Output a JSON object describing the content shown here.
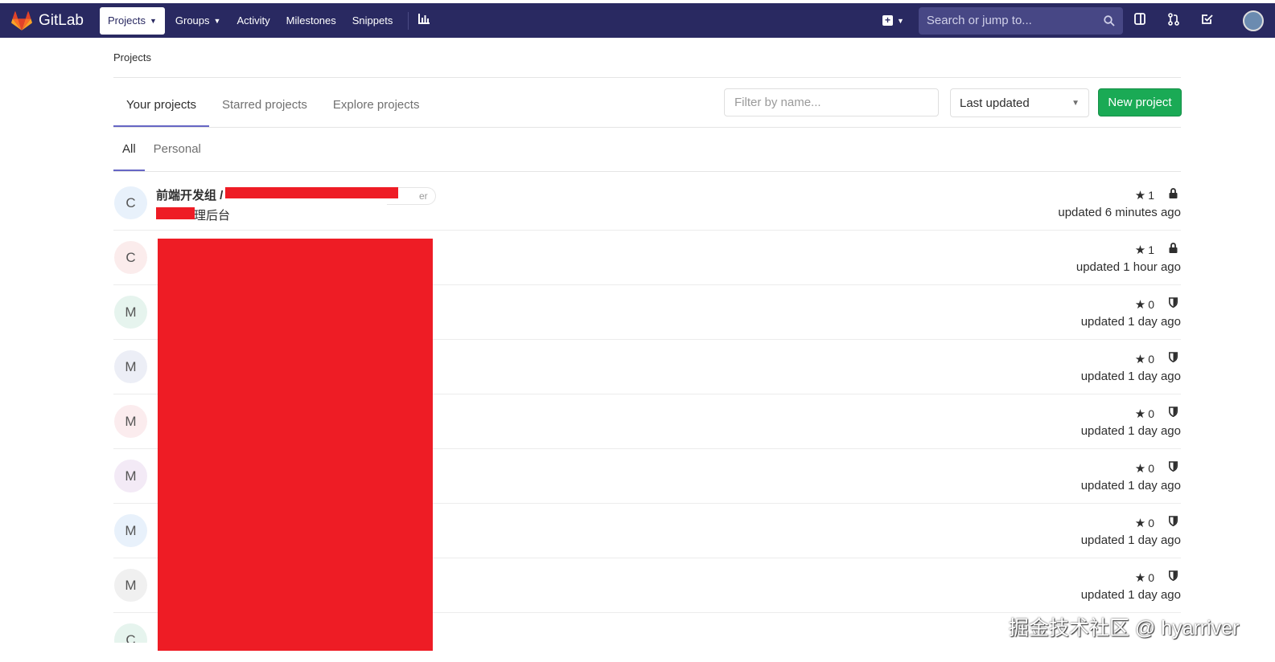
{
  "navbar": {
    "brand": "GitLab",
    "items": [
      {
        "label": "Projects",
        "active": true,
        "has_caret": true
      },
      {
        "label": "Groups",
        "active": false,
        "has_caret": true
      },
      {
        "label": "Activity",
        "active": false,
        "has_caret": false
      },
      {
        "label": "Milestones",
        "active": false,
        "has_caret": false
      },
      {
        "label": "Snippets",
        "active": false,
        "has_caret": false
      }
    ],
    "search_placeholder": "Search or jump to...",
    "icons": [
      "chart-icon",
      "plus-square-icon",
      "search-icon",
      "sidebar-icon",
      "merge-request-icon",
      "todo-icon",
      "user-avatar"
    ]
  },
  "breadcrumb": "Projects",
  "tabs": [
    {
      "label": "Your projects",
      "active": true
    },
    {
      "label": "Starred projects",
      "active": false
    },
    {
      "label": "Explore projects",
      "active": false
    }
  ],
  "filter": {
    "placeholder": "Filter by name..."
  },
  "sort": {
    "selected": "Last updated"
  },
  "new_project_label": "New project",
  "subtabs": [
    {
      "label": "All",
      "active": true
    },
    {
      "label": "Personal",
      "active": false
    }
  ],
  "projects": [
    {
      "letter": "C",
      "avatar_bg": "#e8f1fb",
      "title": "前端开发组 /",
      "title_tail": "er",
      "desc": "理后台",
      "stars": "1",
      "visibility": "lock-icon",
      "updated": "updated 6 minutes ago"
    },
    {
      "letter": "C",
      "avatar_bg": "#fbecec",
      "title": "",
      "desc": "",
      "stars": "1",
      "visibility": "lock-icon",
      "updated": "updated 1 hour ago"
    },
    {
      "letter": "M",
      "avatar_bg": "#e6f4ee",
      "title": "",
      "desc": "",
      "stars": "0",
      "visibility": "shield-icon",
      "updated": "updated 1 day ago"
    },
    {
      "letter": "M",
      "avatar_bg": "#eceef6",
      "title": "",
      "desc": "",
      "stars": "0",
      "visibility": "shield-icon",
      "updated": "updated 1 day ago"
    },
    {
      "letter": "M",
      "avatar_bg": "#fbecee",
      "title": "",
      "desc": "",
      "stars": "0",
      "visibility": "shield-icon",
      "updated": "updated 1 day ago"
    },
    {
      "letter": "M",
      "avatar_bg": "#f3eaf6",
      "title": "",
      "desc": "",
      "stars": "0",
      "visibility": "shield-icon",
      "updated": "updated 1 day ago"
    },
    {
      "letter": "M",
      "avatar_bg": "#e8f1fb",
      "title": "",
      "desc": "",
      "stars": "0",
      "visibility": "shield-icon",
      "updated": "updated 1 day ago"
    },
    {
      "letter": "M",
      "avatar_bg": "#f0f0f0",
      "title": "",
      "desc": "",
      "stars": "0",
      "visibility": "shield-icon",
      "updated": "updated 1 day ago"
    },
    {
      "letter": "C",
      "avatar_bg": "#e6f4ee",
      "title": "",
      "desc": "",
      "stars": "",
      "visibility": "",
      "updated": ""
    }
  ],
  "watermark": "掘金技术社区 @ hyarriver",
  "colors": {
    "navbar": "#292961",
    "accent_tab": "#6666c4",
    "new_button": "#1aaa55",
    "redaction": "#ee1c25"
  }
}
